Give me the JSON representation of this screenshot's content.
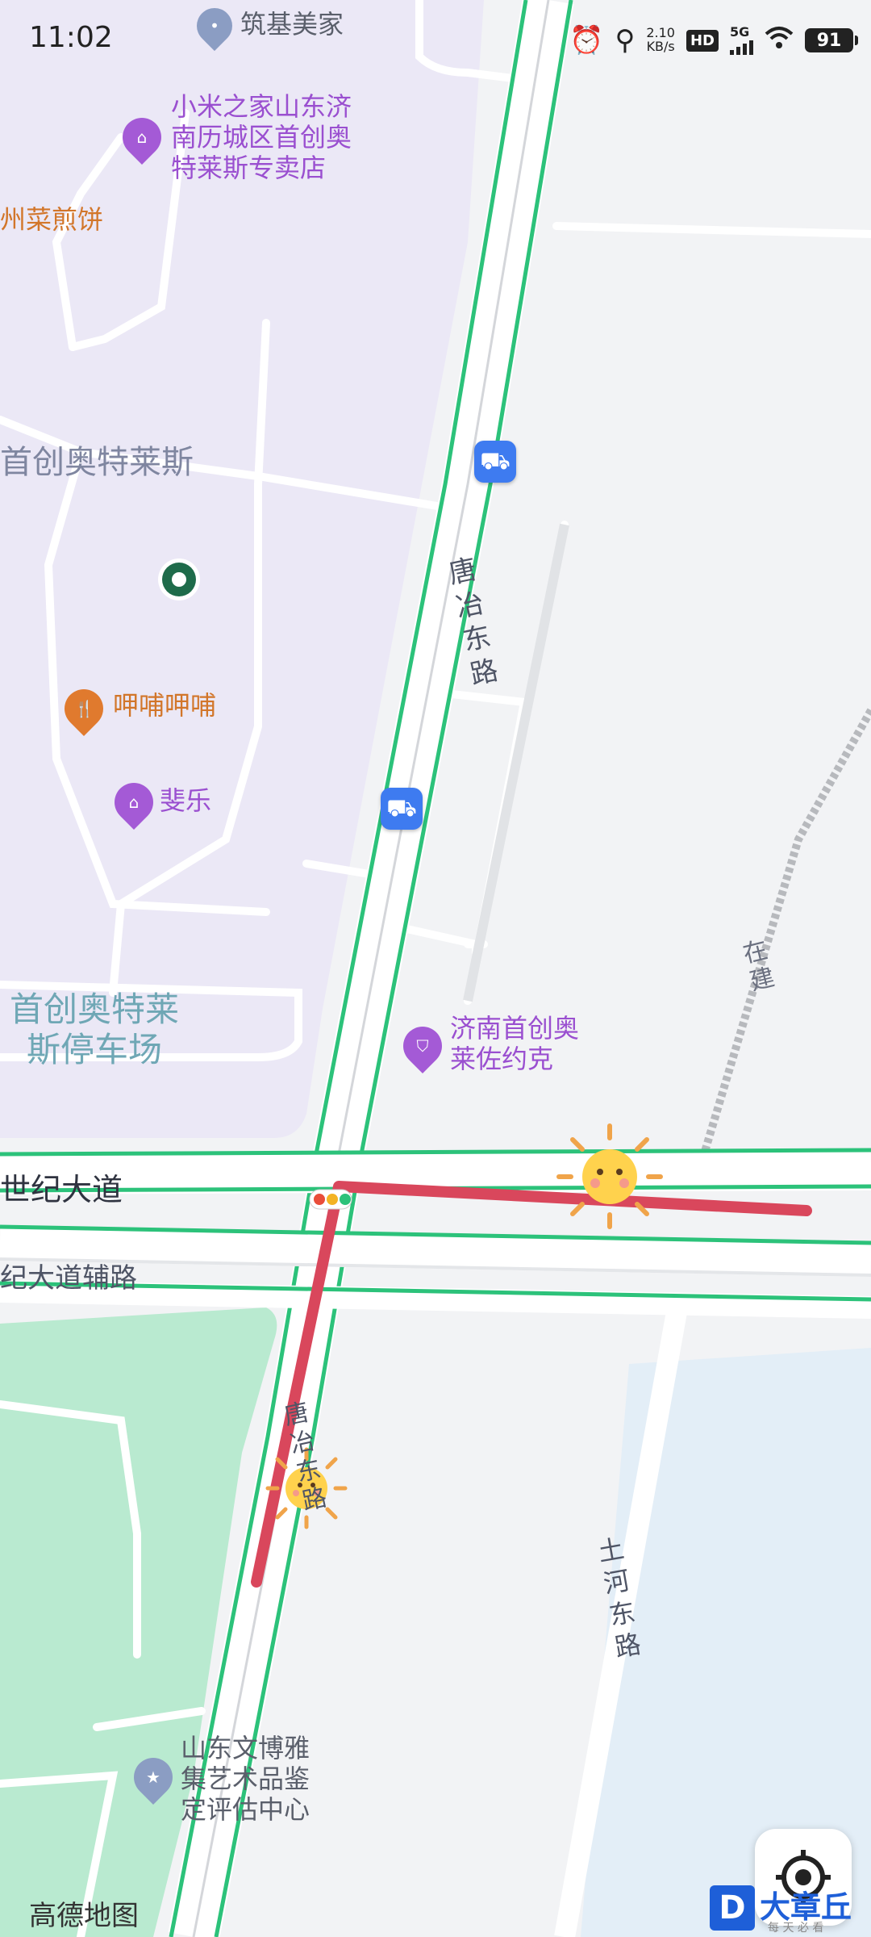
{
  "status_bar": {
    "time": "11:02",
    "net_speed_value": "2.10",
    "net_speed_unit": "KB/s",
    "hd_label": "HD",
    "network_label": "5G",
    "battery": "91",
    "icons": [
      "alarm-icon",
      "location-icon",
      "wifi-icon"
    ]
  },
  "map_labels": {
    "zhuji": "筑基美家",
    "xiaomi": "小米之家山东济\n南历城区首创奥\n特莱斯专卖店",
    "jianbing": "州菜煎饼",
    "shouchuang": "首创奥特莱斯",
    "bubu": "呷哺呷哺",
    "feile": "斐乐",
    "parking": "首创奥特莱\n斯停车场",
    "lacoste": "济南首创奥\n莱佐约克",
    "tangye_road": "唐\n冶\n东\n路",
    "zaijian": "在\n建",
    "century_ave": "世纪大道",
    "century_aux": "纪大道辅路",
    "tangye_road_2": "唐\n冶\n东\n路",
    "shihe_road": "土\n河\n东\n路",
    "art_center": "山东文博雅\n集艺术品鉴\n定评估中心",
    "amap_logo": "高德地图",
    "brand_logo": "大章丘",
    "brand_sub": "每 天 必 看",
    "brand_d": "D"
  },
  "colors": {
    "poi_purple": "#a45ad6",
    "poi_orange": "#e07a2e",
    "poi_blue_grey": "#8b9dc3",
    "bus_blue": "#3e7bf0",
    "route_red": "#d9475c",
    "road_green": "#2cc27a",
    "mall_area": "#ebe8f6",
    "park_area": "#b9ead0",
    "water_area": "#e3eef7"
  }
}
